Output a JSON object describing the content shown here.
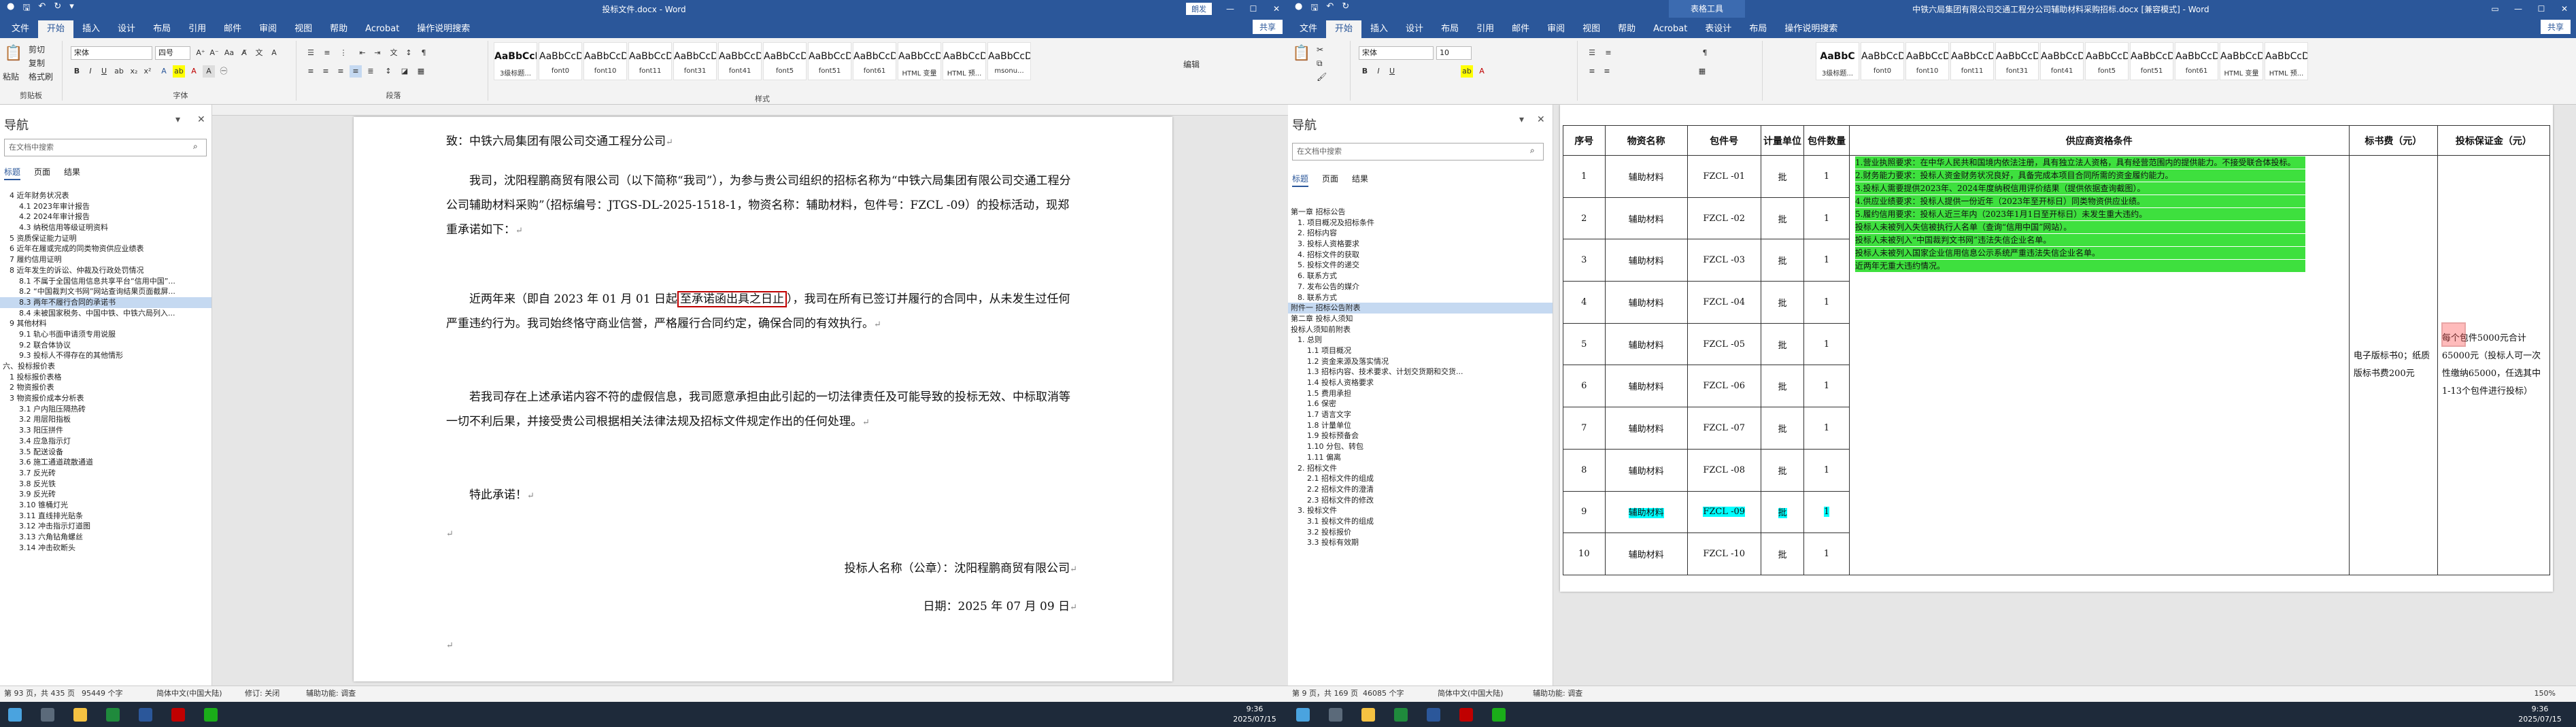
{
  "left": {
    "title": "投标文件.docx - Word",
    "user": "朗发",
    "tabs": [
      "文件",
      "开始",
      "插入",
      "设计",
      "布局",
      "引用",
      "邮件",
      "审阅",
      "视图",
      "帮助",
      "Acrobat",
      "操作说明搜索"
    ],
    "share": "共享",
    "ribbon": {
      "clipboard": {
        "paste": "粘贴",
        "cut": "剪切",
        "copy": "复制",
        "painter": "格式刷",
        "label": "剪贴板"
      },
      "font": {
        "name": "宋体",
        "size": "四号",
        "label": "字体"
      },
      "paragraph_label": "段落",
      "styles": [
        {
          "sample": "AaBbCcDd",
          "name": "3级标题..."
        },
        {
          "sample": "AaBbCcDd",
          "name": "font0"
        },
        {
          "sample": "AaBbCcDd",
          "name": "font10"
        },
        {
          "sample": "AaBbCcDd",
          "name": "font11"
        },
        {
          "sample": "AaBbCcDd",
          "name": "font31"
        },
        {
          "sample": "AaBbCcDd",
          "name": "font41"
        },
        {
          "sample": "AaBbCcDd",
          "name": "font5"
        },
        {
          "sample": "AaBbCcDd",
          "name": "font51"
        },
        {
          "sample": "AaBbCcDd",
          "name": "font61"
        },
        {
          "sample": "AaBbCcDd",
          "name": "HTML 变量"
        },
        {
          "sample": "AaBbCcDd",
          "name": "HTML 预..."
        },
        {
          "sample": "AaBbCcDd",
          "name": "msonu..."
        }
      ],
      "styles_label": "样式",
      "edit": "编辑"
    },
    "nav": {
      "title": "导航",
      "search": "在文档中搜索",
      "tabs": [
        "标题",
        "页面",
        "结果"
      ],
      "items": [
        "4 近年财务状况表",
        "4.1 2023年审计报告",
        "4.2 2024年审计报告",
        "4.3 纳税信用等级证明资料",
        "5 资质保证能力证明",
        "6 近年在履或完成的同类物资供应业绩表",
        "7 履约信用证明",
        "8 近年发生的诉讼、仲裁及行政处罚情况",
        "8.1 不属于全国信用信息共享平台“信用中国”...",
        "8.2 “中国裁判文书网”网站查询结果页面截屏...",
        "8.3 两年不履行合同的承诺书",
        "8.4 未被国家税务、中国中铁、中铁六局列入...",
        "9 其他材料",
        "9.1 轨心书面申请须专用说服",
        "9.2 联合体协议",
        "9.3 投标人不得存在的其他情形",
        "六、投标报价表",
        "1 投标报价表格",
        "2 物资报价表",
        "3 物资报价成本分析表",
        "3.1 户内阻压隔热砖",
        "3.2 用层阳指板",
        "3.3 阳压拼件",
        "3.4 应急指示灯",
        "3.5 配送设备",
        "3.6 施工通道疏散通道",
        "3.7 反光砖",
        "3.8 反光铁",
        "3.9 反光砖",
        "3.10 锥桶灯光",
        "3.11 直线排光贴条",
        "3.12 冲击指示灯道图",
        "3.13 六角钻角螺丝",
        "3.14 冲击砍断头"
      ],
      "selected_index": 10
    },
    "doc": {
      "p1": "致：中铁六局集团有限公司交通工程分公司",
      "p2": "我司，沈阳程鹏商贸有限公司（以下简称“我司”），为参与贵公司组织的招标名称为“中铁六局集团有限公司交通工程分公司辅助材料采购”（招标编号：JTGS-DL-2025-1518-1，物资名称：辅助材料，包件号：FZCL -09）的投标活动，现郑重承诺如下：",
      "p3a": "近两年来（即自 2023 年 01 月 01 日起",
      "p3box": "至承诺函出具之日止",
      "p3b": "），我司在所有已签订并履行的合同中，从未发生过任何严重违约行为。我司始终恪守商业信誉，严格履行合同约定，确保合同的有效执行。",
      "p4": "若我司存在上述承诺内容不符的虚假信息，我司愿意承担由此引起的一切法律责任及可能导致的投标无效、中标取消等一切不利后果，并接受贵公司根据相关法律法规及招标文件规定作出的任何处理。",
      "p5": "特此承诺！",
      "sig1": "投标人名称（公章）：沈阳程鹏商贸有限公司",
      "sig2": "日期：2025 年 07 月 09 日"
    },
    "status": {
      "page": "第 93 页，共 435 页",
      "words": "95449 个字",
      "lang": "简体中文(中国大陆)",
      "track": "修订: 关闭",
      "access": "辅助功能: 调查",
      "zoom": "150%"
    }
  },
  "right": {
    "title": "中铁六局集团有限公司交通工程分公司辅助材料采购招标.docx [兼容模式] - Word",
    "context": "表格工具",
    "tabs": [
      "文件",
      "开始",
      "插入",
      "设计",
      "布局",
      "引用",
      "邮件",
      "审阅",
      "视图",
      "帮助",
      "Acrobat",
      "表设计",
      "布局",
      "操作说明搜索"
    ],
    "share": "共享",
    "ribbon": {
      "font": {
        "name": "宋体",
        "size": "10"
      },
      "styles": [
        {
          "sample": "AaBbC",
          "name": "3级标题..."
        },
        {
          "sample": "AaBbCcDd",
          "name": "font0"
        },
        {
          "sample": "AaBbCcDd",
          "name": "font10"
        },
        {
          "sample": "AaBbCcDd",
          "name": "font11"
        },
        {
          "sample": "AaBbCcDd",
          "name": "font31"
        },
        {
          "sample": "AaBbCcDd",
          "name": "font41"
        },
        {
          "sample": "AaBbCcDd",
          "name": "font5"
        },
        {
          "sample": "AaBbCcDd",
          "name": "font51"
        },
        {
          "sample": "AaBbCcDd",
          "name": "font61"
        },
        {
          "sample": "AaBbCcDd",
          "name": "HTML 变量"
        },
        {
          "sample": "AaBbCcDd",
          "name": "HTML 预..."
        }
      ]
    },
    "nav": {
      "title": "导航",
      "search": "在文档中搜索",
      "tabs": [
        "标题",
        "页面",
        "结果"
      ],
      "items": [
        "第一章 招标公告",
        "1. 项目概况及招标条件",
        "2. 招标内容",
        "3. 投标人资格要求",
        "4. 招标文件的获取",
        "5. 投标文件的递交",
        "6. 联系方式",
        "7. 发布公告的媒介",
        "8. 联系方式",
        "附件一 招标公告附表",
        "第二章 投标人须知",
        "投标人须知前附表",
        "1. 总则",
        "1.1 项目概况",
        "1.2 资金来源及落实情况",
        "1.3 招标内容、技术要求、计划交货期和交货...",
        "1.4 投标人资格要求",
        "1.5 费用承担",
        "1.6 保密",
        "1.7 语言文字",
        "1.8 计量单位",
        "1.9 投标预备会",
        "1.10 分包、转包",
        "1.11 偏离",
        "2. 招标文件",
        "2.1 招标文件的组成",
        "2.2 招标文件的澄清",
        "2.3 招标文件的修改",
        "3. 投标文件",
        "3.1 投标文件的组成",
        "3.2 投标报价",
        "3.3 投标有效期"
      ],
      "selected_index": 9
    },
    "table": {
      "headers": [
        "序号",
        "物资名称",
        "包件号",
        "计量单位",
        "包件数量",
        "供应商资格条件",
        "标书费（元）",
        "投标保证金（元）"
      ],
      "rows": [
        {
          "no": "1",
          "name": "辅助材料",
          "pkg": "FZCL -01",
          "unit": "批",
          "qty": "1"
        },
        {
          "no": "2",
          "name": "辅助材料",
          "pkg": "FZCL -02",
          "unit": "批",
          "qty": "1"
        },
        {
          "no": "3",
          "name": "辅助材料",
          "pkg": "FZCL -03",
          "unit": "批",
          "qty": "1"
        },
        {
          "no": "4",
          "name": "辅助材料",
          "pkg": "FZCL -04",
          "unit": "批",
          "qty": "1"
        },
        {
          "no": "5",
          "name": "辅助材料",
          "pkg": "FZCL -05",
          "unit": "批",
          "qty": "1"
        },
        {
          "no": "6",
          "name": "辅助材料",
          "pkg": "FZCL -06",
          "unit": "批",
          "qty": "1"
        },
        {
          "no": "7",
          "name": "辅助材料",
          "pkg": "FZCL -07",
          "unit": "批",
          "qty": "1"
        },
        {
          "no": "8",
          "name": "辅助材料",
          "pkg": "FZCL -08",
          "unit": "批",
          "qty": "1"
        },
        {
          "no": "9",
          "name": "辅助材料",
          "pkg": "FZCL -09",
          "unit": "批",
          "qty": "1"
        },
        {
          "no": "10",
          "name": "辅助材料",
          "pkg": "FZCL -10",
          "unit": "批",
          "qty": "1"
        }
      ],
      "conditions": [
        "1.营业执照要求：在中华人民共和国境内依法注册，具有独立法人资格，具有经营范围内的提供能力。不接受联合体投标。",
        "2.财务能力要求：投标人资金财务状况良好，具备完成本项目合同所需的资金履约能力。",
        "3.投标人需要提供2023年、2024年度纳税信用评价结果（提供依据查询截图）。",
        "4.供应业绩要求：投标人提供一份近年（2023年至开标日）同类物资供应业绩。",
        "5.履约信用要求：投标人近三年内（2023年1月1日至开标日）未发生重大违约。",
        "投标人未被列入失信被执行人名单（查询“信用中国”网站）。",
        "投标人未被列入“中国裁判文书网”违法失信企业名单。",
        "投标人未被列入国家企业信用信息公示系统严重违法失信企业名单。",
        "近两年无重大违约情况。"
      ],
      "fee": "电子版标书0；纸质版标书费200元",
      "deposit": "每个包件5000元合计65000元（投标人可一次性缴纳65000，任选其中1-13个包件进行投标）"
    },
    "status": {
      "page": "第 9 页，共 169 页",
      "words": "46085 个字",
      "lang": "简体中文(中国大陆)",
      "access": "辅助功能: 调查",
      "zoom": "150%"
    }
  },
  "taskbar": {
    "time_left": "9:36",
    "date_left": "2025/07/15",
    "time_right": "9:36",
    "date_right": "2025/07/15"
  },
  "colors": {
    "brand": "#2b579a",
    "highlight_green": "#3ee03e",
    "highlight_cyan": "#00ffff",
    "red_box": "#c00000"
  }
}
